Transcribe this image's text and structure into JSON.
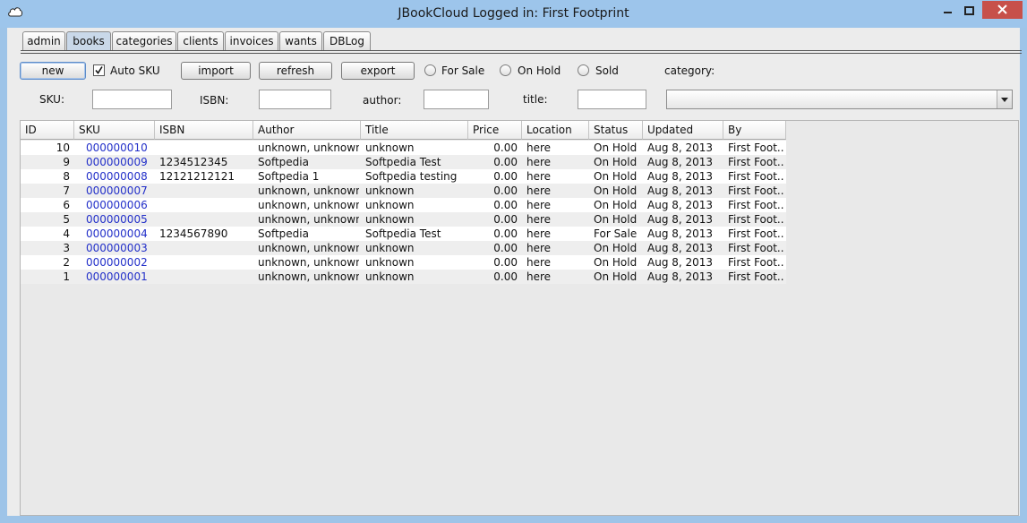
{
  "window": {
    "title": "JBookCloud  Logged in: First Footprint",
    "icons": {
      "app": "cloud-icon",
      "minimize": "minimize-icon",
      "maximize": "maximize-icon",
      "close": "close-icon"
    }
  },
  "tabs": [
    "admin",
    "books",
    "categories",
    "clients",
    "invoices",
    "wants",
    "DBLog"
  ],
  "active_tab": "books",
  "toolbar": {
    "new": "new",
    "auto_sku": "Auto SKU",
    "auto_sku_checked": true,
    "import": "import",
    "refresh": "refresh",
    "export": "export",
    "for_sale": "For Sale",
    "on_hold": "On Hold",
    "sold": "Sold",
    "category": "category:"
  },
  "filters": {
    "sku_label": "SKU:",
    "sku_value": "",
    "isbn_label": "ISBN:",
    "isbn_value": "",
    "author_label": "author:",
    "author_value": "",
    "title_label": "title:",
    "title_value": "",
    "category_value": ""
  },
  "table": {
    "columns": [
      "ID",
      "SKU",
      "ISBN",
      "Author",
      "Title",
      "Price",
      "Location",
      "Status",
      "Updated",
      "By"
    ],
    "rows": [
      [
        "10",
        "000000010",
        "",
        "unknown, unknown",
        "unknown",
        "0.00",
        "here",
        "On Hold",
        "Aug 8, 2013",
        "First Foot..."
      ],
      [
        "9",
        "000000009",
        "1234512345",
        "Softpedia",
        "Softpedia Test",
        "0.00",
        "here",
        "On Hold",
        "Aug 8, 2013",
        "First Foot..."
      ],
      [
        "8",
        "000000008",
        "12121212121",
        "Softpedia 1",
        "Softpedia testing",
        "0.00",
        "here",
        "On Hold",
        "Aug 8, 2013",
        "First Foot..."
      ],
      [
        "7",
        "000000007",
        "",
        "unknown, unknown",
        "unknown",
        "0.00",
        "here",
        "On Hold",
        "Aug 8, 2013",
        "First Foot..."
      ],
      [
        "6",
        "000000006",
        "",
        "unknown, unknown",
        "unknown",
        "0.00",
        "here",
        "On Hold",
        "Aug 8, 2013",
        "First Foot..."
      ],
      [
        "5",
        "000000005",
        "",
        "unknown, unknown",
        "unknown",
        "0.00",
        "here",
        "On Hold",
        "Aug 8, 2013",
        "First Foot..."
      ],
      [
        "4",
        "000000004",
        "1234567890",
        "Softpedia",
        "Softpedia Test",
        "0.00",
        "here",
        "For Sale",
        "Aug 8, 2013",
        "First Foot..."
      ],
      [
        "3",
        "000000003",
        "",
        "unknown, unknown",
        "unknown",
        "0.00",
        "here",
        "On Hold",
        "Aug 8, 2013",
        "First Foot..."
      ],
      [
        "2",
        "000000002",
        "",
        "unknown, unknown",
        "unknown",
        "0.00",
        "here",
        "On Hold",
        "Aug 8, 2013",
        "First Foot..."
      ],
      [
        "1",
        "000000001",
        "",
        "unknown, unknown",
        "unknown",
        "0.00",
        "here",
        "On Hold",
        "Aug 8, 2013",
        "First Foot..."
      ]
    ]
  },
  "colors": {
    "titlebar": "#9dc5eb",
    "close": "#c7504a",
    "sku_link": "#2330c9",
    "panel": "#ececec"
  }
}
